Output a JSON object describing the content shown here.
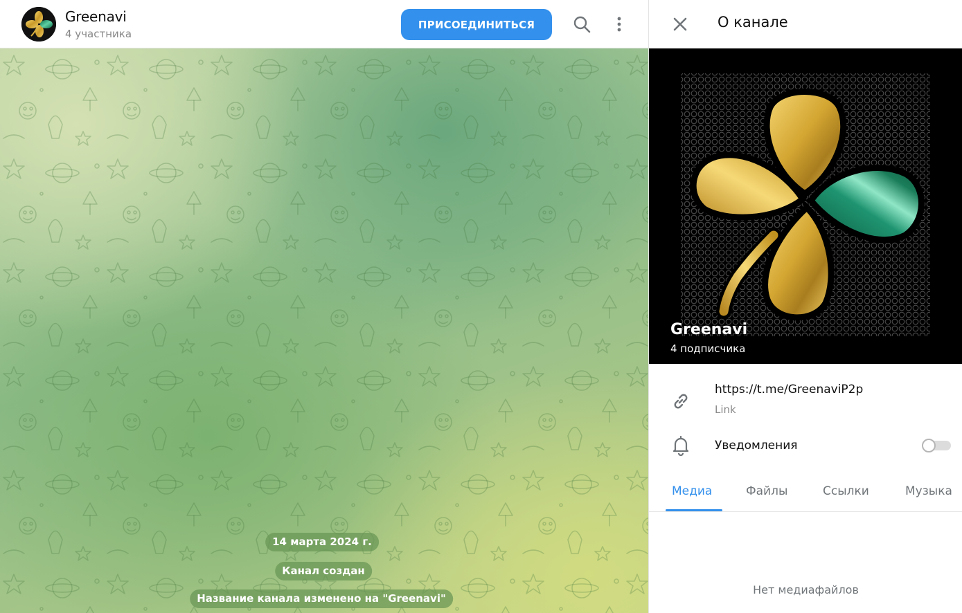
{
  "chat": {
    "title": "Greenavi",
    "members": "4 участника",
    "join_label": "ПРИСОЕДИНИТЬСЯ",
    "search_icon": "search-icon",
    "more_icon": "more-vertical-icon",
    "service_messages": {
      "date": "14 марта 2024 г.",
      "created": "Канал создан",
      "renamed": "Название канала изменено на \"Greenavi\""
    }
  },
  "panel": {
    "title": "О канале",
    "close_icon": "close-icon",
    "channel_name": "Greenavi",
    "subscribers": "4 подписчика",
    "link": {
      "value": "https://t.me/GreenaviP2p",
      "caption": "Link",
      "icon": "link-icon"
    },
    "notifications": {
      "label": "Уведомления",
      "icon": "bell-icon",
      "enabled": false
    },
    "tabs": [
      {
        "label": "Медиа",
        "active": true
      },
      {
        "label": "Файлы",
        "active": false
      },
      {
        "label": "Ссылки",
        "active": false
      },
      {
        "label": "Музыка",
        "active": false
      }
    ],
    "empty_text": "Нет медиафайлов"
  },
  "colors": {
    "accent": "#3390ec",
    "leaf_gold": "#d9ad3c",
    "leaf_green": "#1f8a63",
    "service_bubble": "#6c9a52"
  }
}
